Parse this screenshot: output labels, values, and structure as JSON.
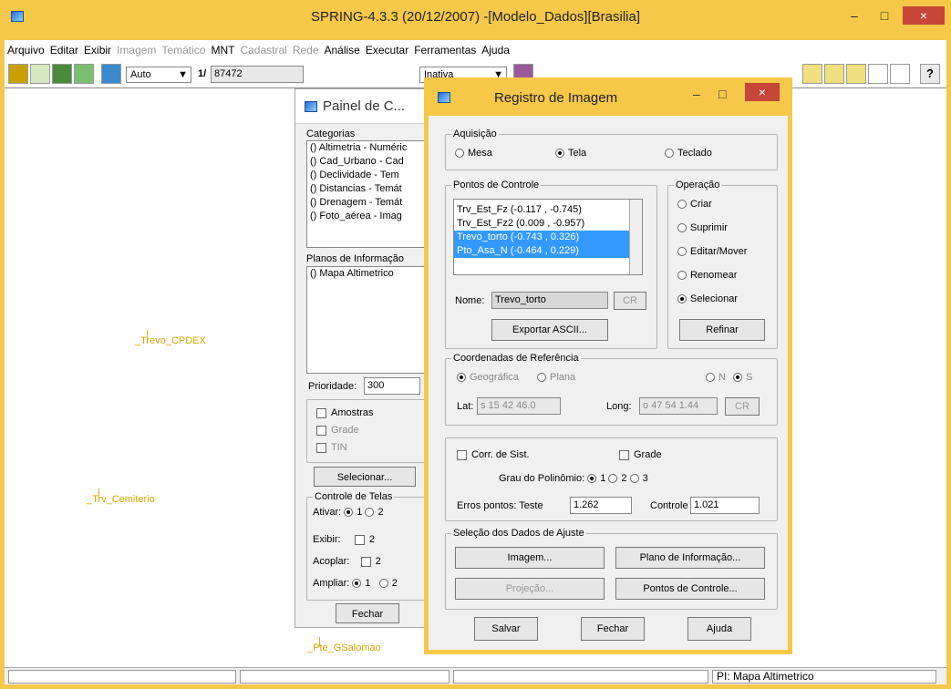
{
  "window": {
    "title": "SPRING-4.3.3 (20/12/2007) -[Modelo_Dados][Brasilia]",
    "minimize": "–",
    "maximize": "□",
    "close": "×"
  },
  "menu": [
    {
      "label": "Arquivo",
      "disabled": false
    },
    {
      "label": "Editar",
      "disabled": false
    },
    {
      "label": "Exibir",
      "disabled": false
    },
    {
      "label": "Imagem",
      "disabled": true
    },
    {
      "label": "Temático",
      "disabled": true
    },
    {
      "label": "MNT",
      "disabled": false
    },
    {
      "label": "Cadastral",
      "disabled": true
    },
    {
      "label": "Rede",
      "disabled": true
    },
    {
      "label": "Análise",
      "disabled": false
    },
    {
      "label": "Executar",
      "disabled": false
    },
    {
      "label": "Ferramentas",
      "disabled": false
    },
    {
      "label": "Ajuda",
      "disabled": false
    }
  ],
  "toolbar": {
    "zoom_mode": "Auto",
    "scale_prefix": "1/",
    "scale": "87472",
    "state": "Inativa",
    "help": "?"
  },
  "canvas": {
    "markers": [
      "_Trevo_CPDEX",
      "_Trv_Cemiterio",
      "_Pte_GSalomao"
    ]
  },
  "status": {
    "pi": "PI: Mapa Altimetrico"
  },
  "panel": {
    "title": "Painel de C...",
    "categorias_label": "Categorias",
    "categorias": [
      "() Altimetria - Numéric",
      "() Cad_Urbano - Cad",
      "() Declividade - Tem",
      "() Distancias - Temát",
      "() Drenagem - Temát",
      "() Foto_aérea - Imag"
    ],
    "planos_label": "Planos de Informação",
    "planos": [
      "() Mapa Altimetrico"
    ],
    "prioridade_label": "Prioridade:",
    "prioridade": "300",
    "amostras": "Amostras",
    "grade": "Grade",
    "tin": "TIN",
    "selecionar": "Selecionar...",
    "controle_label": "Controle de Telas",
    "ativar": "Ativar:",
    "ativar_1": "1",
    "ativar_2": "2",
    "exibir": "Exibir:",
    "exibir_2": "2",
    "acoplar": "Acoplar:",
    "acoplar_2": "2",
    "ampliar": "Ampliar:",
    "ampliar_1": "1",
    "ampliar_2": "2",
    "fechar": "Fechar"
  },
  "dialog": {
    "title": "Registro de Imagem",
    "aquisicao": {
      "label": "Aquisição",
      "options": [
        "Mesa",
        "Tela",
        "Teclado"
      ],
      "selected": "Tela"
    },
    "pontos": {
      "label": "Pontos de Controle",
      "items": [
        "Trv_Est_Fz (-0.117 , -0.745)",
        "Trv_Est_Fz2 (0.009 , -0.957)",
        "Trevo_torto (-0.743 , 0.326)",
        "Pto_Asa_N (-0.464 , 0.229)"
      ],
      "nome_label": "Nome:",
      "nome": "Trevo_torto",
      "cr": "CR",
      "exportar": "Exportar ASCII..."
    },
    "operacao": {
      "label": "Operação",
      "options": [
        "Criar",
        "Suprimir",
        "Editar/Mover",
        "Renomear",
        "Selecionar"
      ],
      "selected": "Selecionar",
      "refinar": "Refinar"
    },
    "coords": {
      "label": "Coordenadas de Referência",
      "geo": "Geográfica",
      "plana": "Plana",
      "n": "N",
      "s": "S",
      "lat_label": "Lat:",
      "lat": "s 15 42 46.0",
      "long_label": "Long:",
      "long": "o 47 54 1.44",
      "cr": "CR"
    },
    "corr": "Corr. de Sist.",
    "grade": "Grade",
    "grau_label": "Grau do Polinômio:",
    "grau_opts": [
      "1",
      "2",
      "3"
    ],
    "erros_label": "Erros pontos:  Teste",
    "teste": "1.262",
    "controle_label": "Controle",
    "controle": "1.021",
    "selecao": {
      "label": "Seleção dos Dados de Ajuste",
      "imagem": "Imagem...",
      "plano": "Plano de Informação...",
      "projecao": "Projeção...",
      "pontos": "Pontos de Controle..."
    },
    "salvar": "Salvar",
    "fechar": "Fechar",
    "ajuda": "Ajuda"
  }
}
